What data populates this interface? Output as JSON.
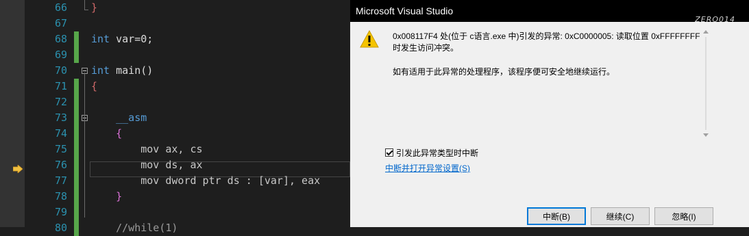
{
  "editor": {
    "line_numbers": [
      "66",
      "67",
      "68",
      "69",
      "70",
      "71",
      "72",
      "73",
      "74",
      "75",
      "76",
      "77",
      "78",
      "79",
      "80"
    ],
    "current_line": "77",
    "lines": [
      {
        "tokens": [
          {
            "t": "}",
            "c": "br-red"
          }
        ]
      },
      {
        "tokens": []
      },
      {
        "tokens": [
          {
            "t": "int",
            "c": "kw"
          },
          {
            "t": " var=0;",
            "c": ""
          }
        ]
      },
      {
        "tokens": []
      },
      {
        "tokens": [
          {
            "t": "int",
            "c": "kw"
          },
          {
            "t": " main()",
            "c": ""
          }
        ]
      },
      {
        "tokens": [
          {
            "t": "{",
            "c": "br-red"
          }
        ]
      },
      {
        "tokens": []
      },
      {
        "tokens": [
          {
            "t": "    __asm",
            "c": "kw"
          }
        ]
      },
      {
        "tokens": [
          {
            "t": "    {",
            "c": "br-pink"
          }
        ]
      },
      {
        "tokens": [
          {
            "t": "        mov ax, cs",
            "c": "reg"
          }
        ]
      },
      {
        "tokens": [
          {
            "t": "        mov ds, ax",
            "c": "reg"
          }
        ]
      },
      {
        "tokens": [
          {
            "t": "        mov dword ptr ds : [var], eax",
            "c": "reg"
          }
        ]
      },
      {
        "tokens": [
          {
            "t": "    }",
            "c": "br-pink"
          }
        ]
      },
      {
        "tokens": []
      },
      {
        "tokens": [
          {
            "t": "    //while(1)",
            "c": "dim"
          }
        ]
      }
    ]
  },
  "dialog": {
    "title": "Microsoft Visual Studio",
    "watermark": "ZERO014",
    "message_line1": "0x008117F4 处(位于 c语言.exe 中)引发的异常: 0xC0000005: 读取位置 0xFFFFFFFF",
    "message_line2": "时发生访问冲突。",
    "message_hint": "如有适用于此异常的处理程序，该程序便可安全地继续运行。",
    "checkbox_label": "引发此异常类型时中断",
    "checkbox_checked": true,
    "settings_link": "中断并打开异常设置(S)",
    "buttons": {
      "break": "中断(B)",
      "continue": "继续(C)",
      "ignore": "忽略(I)"
    },
    "colors": {
      "titlebar": "#000000",
      "warning_icon": "#f5c400",
      "link": "#0066cc",
      "focus_border": "#0078d7"
    }
  }
}
